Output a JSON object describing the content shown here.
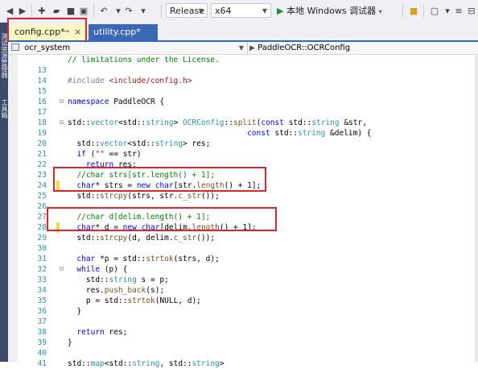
{
  "toolbar": {
    "config_label": "Release",
    "platform_label": "x64",
    "run_label": "本地 Windows 调试器"
  },
  "left_strip": {
    "items": [
      "测试资源管理器",
      "工具箱"
    ]
  },
  "tabs": [
    {
      "label": "config.cpp*",
      "pin": "⊸",
      "close": "×"
    },
    {
      "label": "utility.cpp*"
    }
  ],
  "nav": {
    "scope": "ocr_system",
    "member": "PaddleOCR::OCRConfig"
  },
  "colors": {
    "highlight_box": "#e0242b",
    "active_tab": "#fff8c4",
    "tab_accent": "#3b68b4"
  },
  "code_lines": [
    {
      "n": "",
      "t": [
        [
          "c-cm",
          "// limitations under the License."
        ]
      ]
    },
    {
      "n": "13",
      "t": []
    },
    {
      "n": "14",
      "t": [
        [
          "c-pp",
          "#include "
        ],
        [
          "c-st",
          "<include/config.h>"
        ]
      ]
    },
    {
      "n": "15",
      "t": []
    },
    {
      "n": "16",
      "t": [
        [
          "c-kw",
          "namespace"
        ],
        [
          "c-tx",
          " PaddleOCR {"
        ]
      ]
    },
    {
      "n": "17",
      "t": []
    },
    {
      "n": "18",
      "t": [
        [
          "c-tx",
          "std::"
        ],
        [
          "c-ty",
          "vector"
        ],
        [
          "c-tx",
          "<std::"
        ],
        [
          "c-ty",
          "string"
        ],
        [
          "c-tx",
          "> "
        ],
        [
          "c-ty",
          "OCRConfig"
        ],
        [
          "c-tx",
          "::"
        ],
        [
          "c-fn",
          "split"
        ],
        [
          "c-tx",
          "("
        ],
        [
          "c-kw",
          "const"
        ],
        [
          "c-tx",
          " std::"
        ],
        [
          "c-ty",
          "string"
        ],
        [
          "c-tx",
          " &str,"
        ]
      ]
    },
    {
      "n": "19",
      "t": [
        [
          "c-tx",
          "                                       "
        ],
        [
          "c-kw",
          "const"
        ],
        [
          "c-tx",
          " std::"
        ],
        [
          "c-ty",
          "string"
        ],
        [
          "c-tx",
          " &delim) {"
        ]
      ]
    },
    {
      "n": "20",
      "t": [
        [
          "c-tx",
          "  std::"
        ],
        [
          "c-ty",
          "vector"
        ],
        [
          "c-tx",
          "<std::"
        ],
        [
          "c-ty",
          "string"
        ],
        [
          "c-tx",
          "> res;"
        ]
      ]
    },
    {
      "n": "21",
      "t": [
        [
          "c-tx",
          "  "
        ],
        [
          "c-kw",
          "if"
        ],
        [
          "c-tx",
          " ("
        ],
        [
          "c-st",
          "\"\""
        ],
        [
          "c-tx",
          " == str)"
        ]
      ]
    },
    {
      "n": "22",
      "t": [
        [
          "c-tx",
          "    "
        ],
        [
          "c-kw",
          "return"
        ],
        [
          "c-tx",
          " res;"
        ]
      ]
    },
    {
      "n": "23",
      "t": [
        [
          "c-tx",
          "  "
        ],
        [
          "c-cm",
          "//char strs[str.length() + 1];"
        ]
      ]
    },
    {
      "n": "24",
      "t": [
        [
          "c-tx",
          "  "
        ],
        [
          "c-kw",
          "char"
        ],
        [
          "c-tx",
          "* strs = "
        ],
        [
          "c-kw",
          "new"
        ],
        [
          "c-tx",
          " "
        ],
        [
          "c-kw",
          "char"
        ],
        [
          "c-tx",
          "[str."
        ],
        [
          "c-fn",
          "length"
        ],
        [
          "c-tx",
          "() + 1];"
        ]
      ]
    },
    {
      "n": "25",
      "t": [
        [
          "c-tx",
          "  std::"
        ],
        [
          "c-fn",
          "strcpy"
        ],
        [
          "c-tx",
          "(strs, str."
        ],
        [
          "c-fn",
          "c_str"
        ],
        [
          "c-tx",
          "());"
        ]
      ]
    },
    {
      "n": "26",
      "t": []
    },
    {
      "n": "27",
      "t": [
        [
          "c-tx",
          "  "
        ],
        [
          "c-cm",
          "//char d[delim.length() + 1];"
        ]
      ]
    },
    {
      "n": "28",
      "t": [
        [
          "c-tx",
          "  "
        ],
        [
          "c-kw",
          "char"
        ],
        [
          "c-tx",
          "* d = "
        ],
        [
          "c-kw",
          "new"
        ],
        [
          "c-tx",
          " "
        ],
        [
          "c-kw",
          "char"
        ],
        [
          "c-tx",
          "[delim."
        ],
        [
          "c-fn",
          "length"
        ],
        [
          "c-tx",
          "() + 1];"
        ]
      ]
    },
    {
      "n": "29",
      "t": [
        [
          "c-tx",
          "  std::"
        ],
        [
          "c-fn",
          "strcpy"
        ],
        [
          "c-tx",
          "(d, delim."
        ],
        [
          "c-fn",
          "c_str"
        ],
        [
          "c-tx",
          "());"
        ]
      ]
    },
    {
      "n": "30",
      "t": []
    },
    {
      "n": "31",
      "t": [
        [
          "c-tx",
          "  "
        ],
        [
          "c-kw",
          "char"
        ],
        [
          "c-tx",
          " *p = std::"
        ],
        [
          "c-fn",
          "strtok"
        ],
        [
          "c-tx",
          "(strs, d);"
        ]
      ]
    },
    {
      "n": "32",
      "t": [
        [
          "c-tx",
          "  "
        ],
        [
          "c-kw",
          "while"
        ],
        [
          "c-tx",
          " (p) {"
        ]
      ]
    },
    {
      "n": "33",
      "t": [
        [
          "c-tx",
          "    std::"
        ],
        [
          "c-ty",
          "string"
        ],
        [
          "c-tx",
          " s = p;"
        ]
      ]
    },
    {
      "n": "34",
      "t": [
        [
          "c-tx",
          "    res."
        ],
        [
          "c-fn",
          "push_back"
        ],
        [
          "c-tx",
          "(s);"
        ]
      ]
    },
    {
      "n": "35",
      "t": [
        [
          "c-tx",
          "    p = std::"
        ],
        [
          "c-fn",
          "strtok"
        ],
        [
          "c-tx",
          "(NULL, d);"
        ]
      ]
    },
    {
      "n": "36",
      "t": [
        [
          "c-tx",
          "  }"
        ]
      ]
    },
    {
      "n": "37",
      "t": []
    },
    {
      "n": "38",
      "t": [
        [
          "c-tx",
          "  "
        ],
        [
          "c-kw",
          "return"
        ],
        [
          "c-tx",
          " res;"
        ]
      ]
    },
    {
      "n": "39",
      "t": [
        [
          "c-tx",
          "}"
        ]
      ]
    },
    {
      "n": "40",
      "t": []
    },
    {
      "n": "41",
      "t": [
        [
          "c-tx",
          "std::"
        ],
        [
          "c-ty",
          "map"
        ],
        [
          "c-tx",
          "<std::"
        ],
        [
          "c-ty",
          "string"
        ],
        [
          "c-tx",
          ", std::"
        ],
        [
          "c-ty",
          "string"
        ],
        [
          "c-tx",
          ">"
        ]
      ]
    }
  ]
}
